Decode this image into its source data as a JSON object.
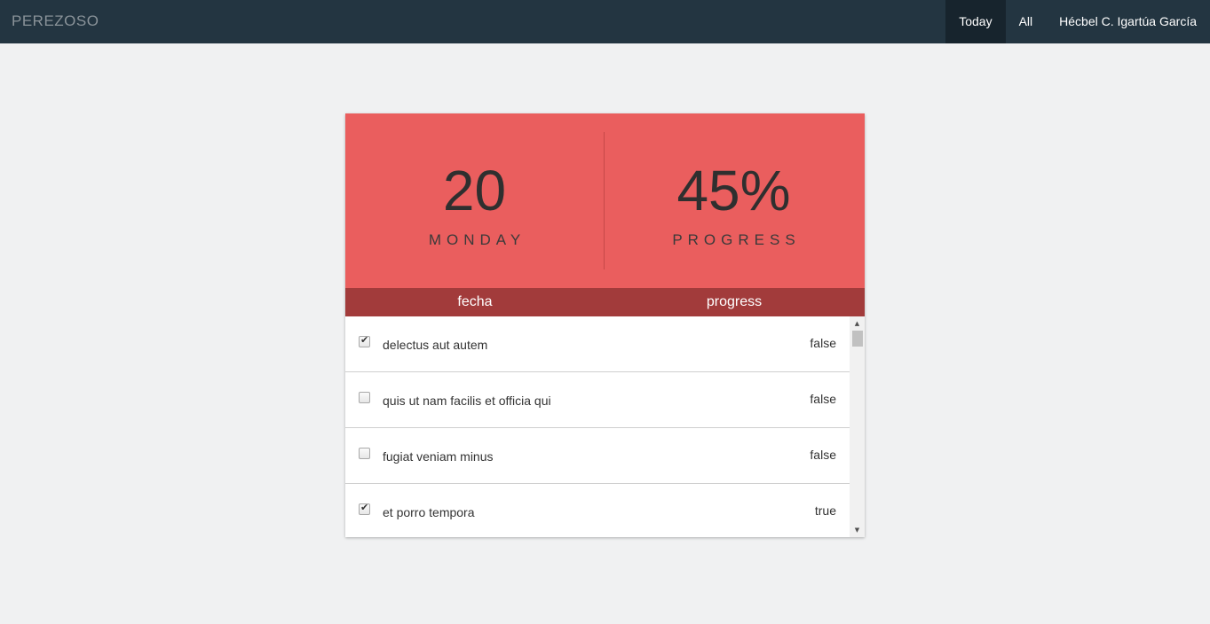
{
  "navbar": {
    "brand": "PEREZOSO",
    "links": [
      {
        "label": "Today",
        "active": true
      },
      {
        "label": "All",
        "active": false
      },
      {
        "label": "Hécbel C. Igartúa García",
        "active": false
      }
    ]
  },
  "hero": {
    "day_number": "20",
    "day_name": "MONDAY",
    "progress_value": "45%",
    "progress_label": "PROGRESS"
  },
  "table": {
    "headers": [
      "fecha",
      "progress"
    ],
    "rows": [
      {
        "checked": true,
        "title": "delectus aut autem",
        "status": "false"
      },
      {
        "checked": false,
        "title": "quis ut nam facilis et officia qui",
        "status": "false"
      },
      {
        "checked": false,
        "title": "fugiat veniam minus",
        "status": "false"
      },
      {
        "checked": true,
        "title": "et porro tempora",
        "status": "true"
      }
    ]
  },
  "colors": {
    "navbar_bg": "#233541",
    "hero_bg": "#ea5e5e",
    "header_bg": "#a23b3b",
    "page_bg": "#f0f1f2"
  },
  "icons": {
    "scroll_up": "scroll-up-arrow-icon",
    "scroll_down": "scroll-down-arrow-icon",
    "checkmark": "checkmark-icon"
  }
}
